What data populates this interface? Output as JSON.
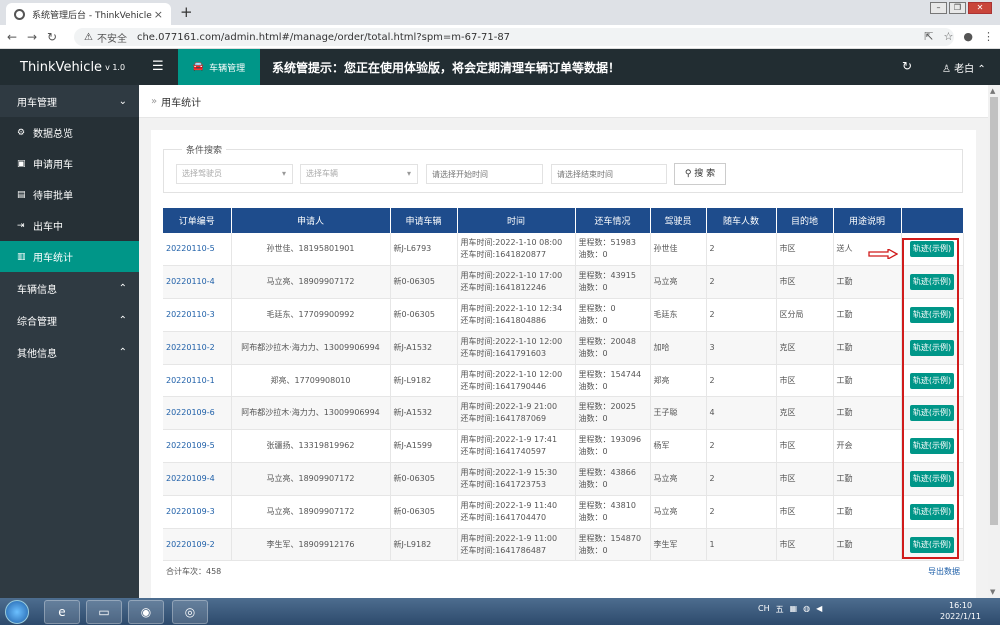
{
  "browser": {
    "tab_title": "系统管理后台 - ThinkVehicle",
    "tab_close": "×",
    "new_tab": "+",
    "insecure_label": "不安全",
    "url": "che.077161.com/admin.html#/manage/order/total.html?spm=m-67-71-87"
  },
  "topbar": {
    "brand": "ThinkVehicle",
    "version": "v 1.0",
    "module_tab": "车辆管理",
    "notice": "系统管提示：您正在使用体验版，将会定期清理车辆订单等数据！",
    "user": "老白"
  },
  "sidebar": {
    "groups": [
      {
        "label": "用车管理"
      },
      {
        "label": "车辆信息"
      },
      {
        "label": "综合管理"
      },
      {
        "label": "其他信息"
      }
    ],
    "items": [
      {
        "label": "数据总览",
        "icon": "gear-icon"
      },
      {
        "label": "申请用车",
        "icon": "car-icon"
      },
      {
        "label": "待审批单",
        "icon": "form-icon"
      },
      {
        "label": "出车中",
        "icon": "exit-icon"
      },
      {
        "label": "用车统计",
        "icon": "chart-icon"
      }
    ]
  },
  "breadcrumb": {
    "label": "用车统计"
  },
  "search": {
    "legend": "条件搜索",
    "driver_placeholder": "选择驾驶员",
    "vehicle_placeholder": "选择车辆",
    "start_placeholder": "请选择开始时间",
    "end_placeholder": "请选择结束时间",
    "button": "搜 索"
  },
  "table": {
    "headers": [
      "订单编号",
      "申请人",
      "申请车辆",
      "时间",
      "还车情况",
      "驾驶员",
      "随车人数",
      "目的地",
      "用途说明",
      ""
    ],
    "action_label": "轨迹(示例)",
    "rows": [
      {
        "id": "20220110-5",
        "applicant": "孙世佳、18195801901",
        "vehicle": "新J-L6793",
        "use_time": "用车时间:2022-1-10 08:00",
        "return_time": "还车时间:1641820877",
        "mileage": "里程数：51983",
        "fuel": "油数：0",
        "driver": "孙世佳",
        "people": "2",
        "dest": "市区",
        "purpose": "送人"
      },
      {
        "id": "20220110-4",
        "applicant": "马立亮、18909907172",
        "vehicle": "新0-06305",
        "use_time": "用车时间:2022-1-10 17:00",
        "return_time": "还车时间:1641812246",
        "mileage": "里程数：43915",
        "fuel": "油数：0",
        "driver": "马立亮",
        "people": "2",
        "dest": "市区",
        "purpose": "工勤"
      },
      {
        "id": "20220110-3",
        "applicant": "毛廷东、17709900992",
        "vehicle": "新0-06305",
        "use_time": "用车时间:2022-1-10 12:34",
        "return_time": "还车时间:1641804886",
        "mileage": "里程数：0",
        "fuel": "油数：0",
        "driver": "毛廷东",
        "people": "2",
        "dest": "区分局",
        "purpose": "工勤"
      },
      {
        "id": "20220110-2",
        "applicant": "阿布都沙拉木·海力力、13009906994",
        "vehicle": "新J-A1532",
        "use_time": "用车时间:2022-1-10 12:00",
        "return_time": "还车时间:1641791603",
        "mileage": "里程数：20048",
        "fuel": "油数：0",
        "driver": "加哈",
        "people": "3",
        "dest": "克区",
        "purpose": "工勤"
      },
      {
        "id": "20220110-1",
        "applicant": "郑亮、17709908010",
        "vehicle": "新J-L9182",
        "use_time": "用车时间:2022-1-10 12:00",
        "return_time": "还车时间:1641790446",
        "mileage": "里程数：154744",
        "fuel": "油数：0",
        "driver": "郑亮",
        "people": "2",
        "dest": "市区",
        "purpose": "工勤"
      },
      {
        "id": "20220109-6",
        "applicant": "阿布都沙拉木·海力力、13009906994",
        "vehicle": "新J-A1532",
        "use_time": "用车时间:2022-1-9 21:00",
        "return_time": "还车时间:1641787069",
        "mileage": "里程数：20025",
        "fuel": "油数：0",
        "driver": "王子聪",
        "people": "4",
        "dest": "克区",
        "purpose": "工勤"
      },
      {
        "id": "20220109-5",
        "applicant": "张疆扬、13319819962",
        "vehicle": "新J-A1599",
        "use_time": "用车时间:2022-1-9 17:41",
        "return_time": "还车时间:1641740597",
        "mileage": "里程数：193096",
        "fuel": "油数：0",
        "driver": "杨军",
        "people": "2",
        "dest": "市区",
        "purpose": "开会"
      },
      {
        "id": "20220109-4",
        "applicant": "马立亮、18909907172",
        "vehicle": "新0-06305",
        "use_time": "用车时间:2022-1-9 15:30",
        "return_time": "还车时间:1641723753",
        "mileage": "里程数：43866",
        "fuel": "油数：0",
        "driver": "马立亮",
        "people": "2",
        "dest": "市区",
        "purpose": "工勤"
      },
      {
        "id": "20220109-3",
        "applicant": "马立亮、18909907172",
        "vehicle": "新0-06305",
        "use_time": "用车时间:2022-1-9 11:40",
        "return_time": "还车时间:1641704470",
        "mileage": "里程数：43810",
        "fuel": "油数：0",
        "driver": "马立亮",
        "people": "2",
        "dest": "市区",
        "purpose": "工勤"
      },
      {
        "id": "20220109-2",
        "applicant": "李生军、18909912176",
        "vehicle": "新J-L9182",
        "use_time": "用车时间:2022-1-9 11:00",
        "return_time": "还车时间:1641786487",
        "mileage": "里程数：154870",
        "fuel": "油数：0",
        "driver": "李生军",
        "people": "1",
        "dest": "市区",
        "purpose": "工勤"
      }
    ]
  },
  "footer": {
    "total": "合计车次：458",
    "export": "导出数据"
  },
  "taskbar": {
    "ime": "CH",
    "time": "16:10",
    "date": "2022/1/11"
  }
}
